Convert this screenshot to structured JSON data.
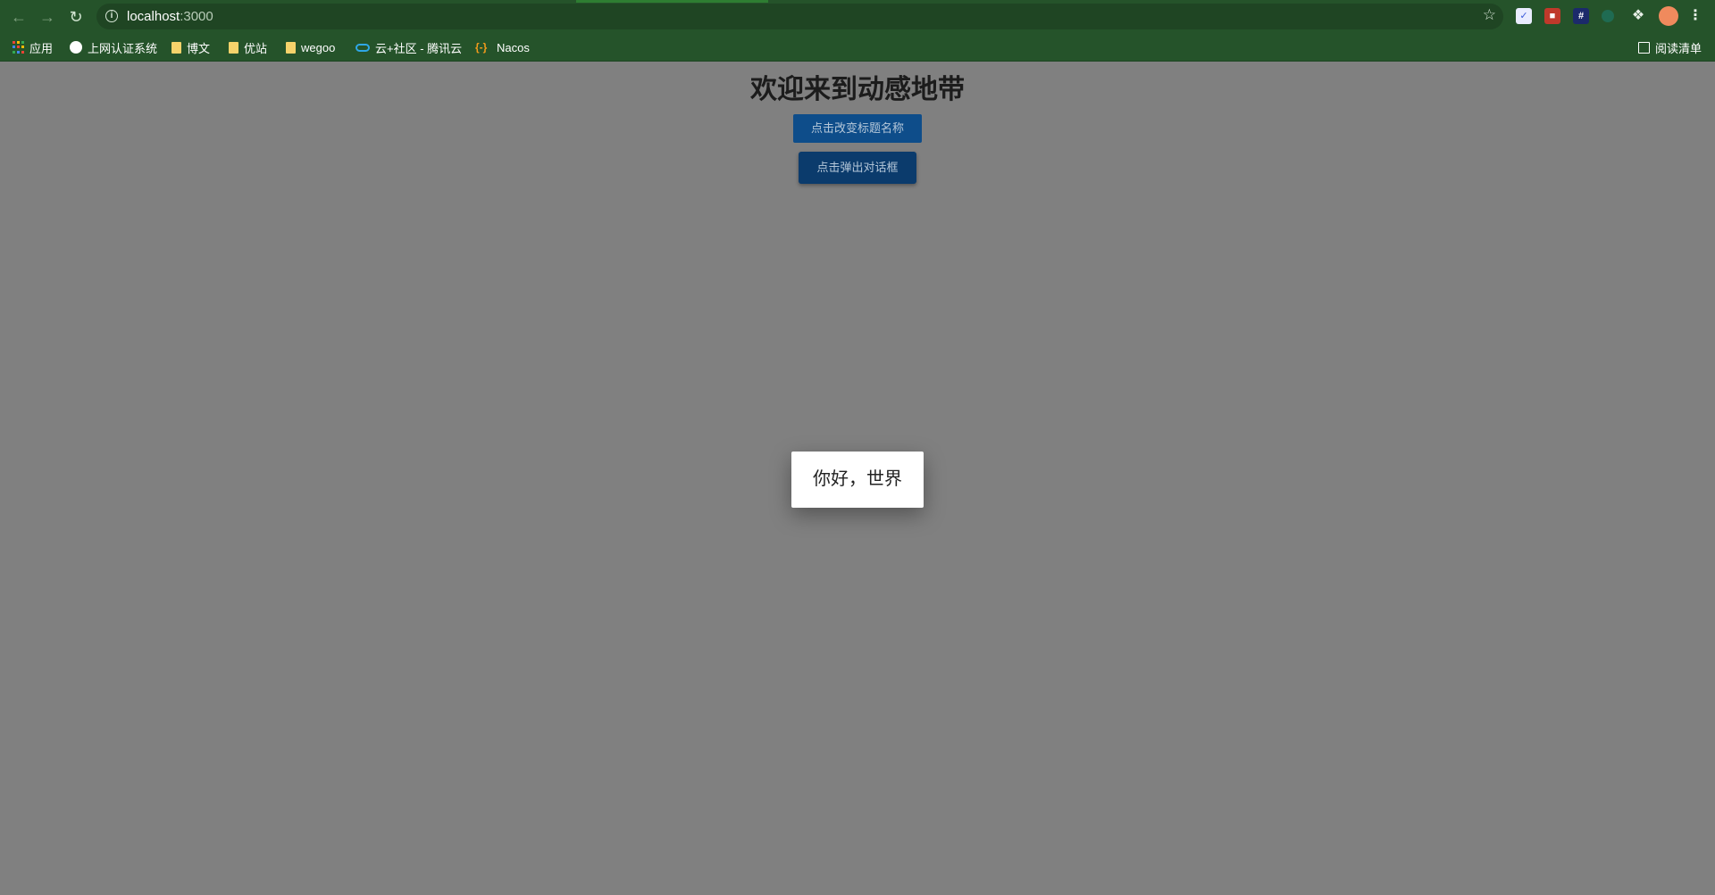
{
  "browser": {
    "url_host": "localhost",
    "url_port": ":3000",
    "bookmarks": [
      {
        "label": "应用",
        "icon": "apps-grid-icon"
      },
      {
        "label": "上网认证系统",
        "icon": "globe-icon"
      },
      {
        "label": "博文",
        "icon": "folder-icon"
      },
      {
        "label": "优站",
        "icon": "folder-icon"
      },
      {
        "label": "wegoo",
        "icon": "folder-icon"
      },
      {
        "label": "云+社区 - 腾讯云",
        "icon": "cloud-icon"
      },
      {
        "label": "Nacos",
        "icon": "nacos-icon"
      }
    ],
    "reading_list": "阅读清单",
    "colors": {
      "chrome": "#25532a",
      "omnibox": "#1f4523",
      "folder": "#f6d36b"
    }
  },
  "page": {
    "title": "欢迎来到动感地带",
    "buttons": {
      "change_title": "点击改变标题名称",
      "open_dialog": "点击弹出对话框"
    },
    "dialog_text": "你好，世界",
    "colors": {
      "overlay": "#808080",
      "button_primary": "#0e4d8a"
    }
  }
}
